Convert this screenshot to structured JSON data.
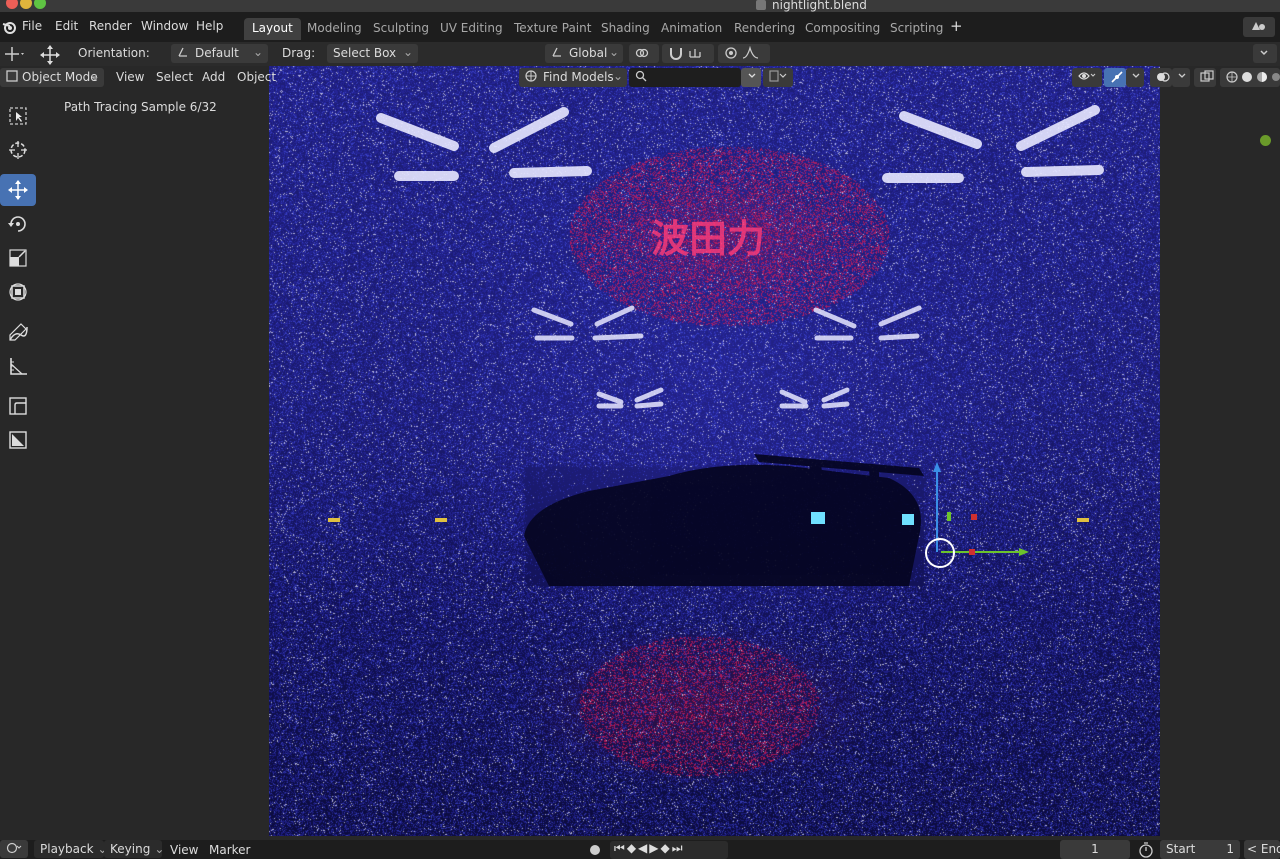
{
  "window": {
    "title": "nightlight.blend"
  },
  "menu": {
    "file": "File",
    "edit": "Edit",
    "render": "Render",
    "window": "Window",
    "help": "Help"
  },
  "workspaces": {
    "tabs": [
      "Layout",
      "Modeling",
      "Sculpting",
      "UV Editing",
      "Texture Paint",
      "Shading",
      "Animation",
      "Rendering",
      "Compositing",
      "Scripting"
    ],
    "add": "+"
  },
  "tool_header": {
    "orientation_label": "Orientation:",
    "orientation_value": "Default",
    "drag_label": "Drag:",
    "drag_value": "Select Box",
    "transform_orientation": "Global"
  },
  "viewport_header": {
    "mode": "Object Mode",
    "view": "View",
    "select": "Select",
    "add": "Add",
    "object": "Object",
    "find_models": "Find Models",
    "search_placeholder": ""
  },
  "viewport": {
    "status": "Path Tracing Sample 6/32"
  },
  "timeline": {
    "playback": "Playback",
    "keying": "Keying",
    "view": "View",
    "marker": "Marker",
    "current_frame": "1",
    "start_label": "Start",
    "start_value": "1",
    "end_label": "< End"
  },
  "colors": {
    "accent": "#4772b3",
    "active_tool_bg": "#4772b3",
    "status_green": "#6a9a2a"
  },
  "icons": {
    "tools": [
      "select-box-icon",
      "cursor-icon",
      "move-icon",
      "rotate-icon",
      "scale-icon",
      "transform-icon",
      "annotate-icon",
      "measure-icon",
      "add-cube-icon",
      "add-plane-icon"
    ]
  }
}
